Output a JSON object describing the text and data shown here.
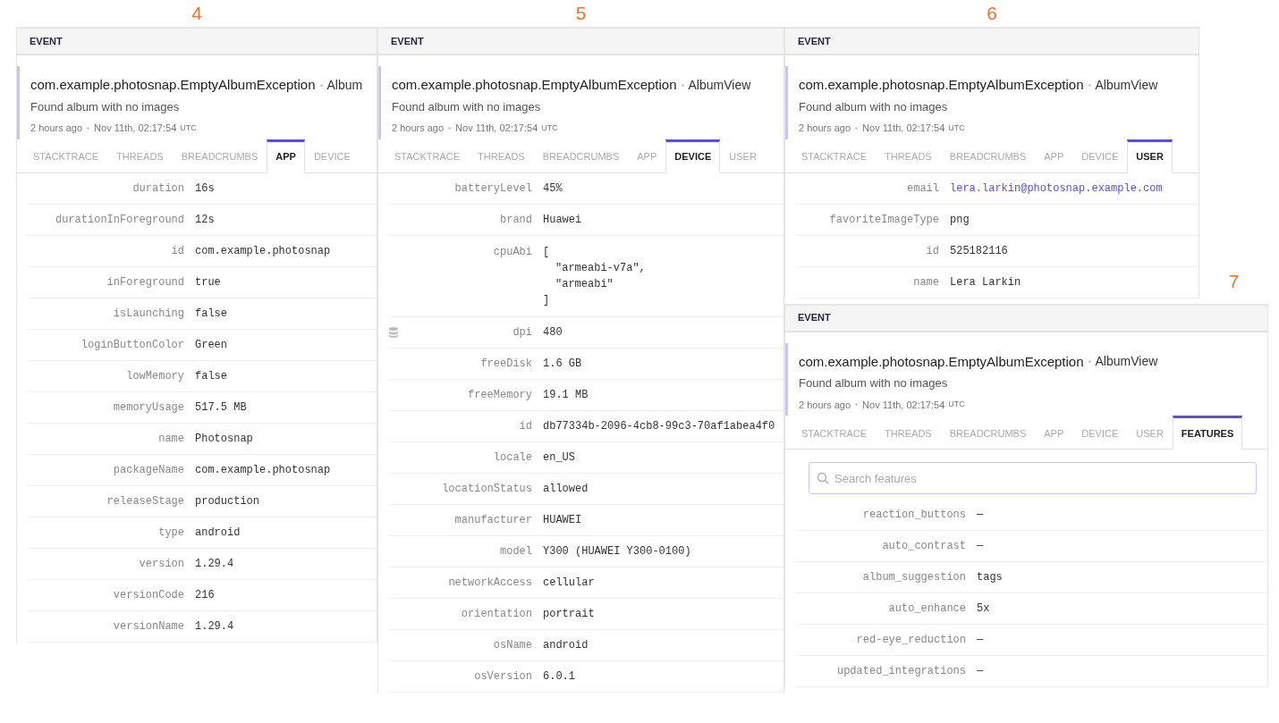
{
  "panels": [
    {
      "number": "4",
      "header": "EVENT",
      "error_class": "com.example.photosnap.EmptyAlbumException",
      "context": "Album",
      "message": "Found album with no images",
      "relative_time": "2 hours ago",
      "timestamp": "Nov 11th, 02:17:54",
      "timezone": "UTC",
      "tabs": [
        {
          "label": "STACKTRACE",
          "selected": false
        },
        {
          "label": "THREADS",
          "selected": false
        },
        {
          "label": "BREADCRUMBS",
          "selected": false
        },
        {
          "label": "APP",
          "selected": true
        },
        {
          "label": "DEVICE",
          "selected": false
        }
      ],
      "rows": [
        {
          "kind": "plain",
          "key": "duration",
          "value": "16s"
        },
        {
          "kind": "plain",
          "key": "durationInForeground",
          "value": "12s"
        },
        {
          "kind": "plain",
          "key": "id",
          "value": "com.example.photosnap"
        },
        {
          "kind": "plain",
          "key": "inForeground",
          "value": "true"
        },
        {
          "kind": "plain",
          "key": "isLaunching",
          "value": "false"
        },
        {
          "kind": "plain",
          "key": "loginButtonColor",
          "value": "Green"
        },
        {
          "kind": "plain",
          "key": "lowMemory",
          "value": "false"
        },
        {
          "kind": "plain",
          "key": "memoryUsage",
          "value": "517.5 MB"
        },
        {
          "kind": "plain",
          "key": "name",
          "value": "Photosnap"
        },
        {
          "kind": "plain",
          "key": "packageName",
          "value": "com.example.photosnap"
        },
        {
          "kind": "plain",
          "key": "releaseStage",
          "value": "production"
        },
        {
          "kind": "plain",
          "key": "type",
          "value": "android"
        },
        {
          "kind": "plain",
          "key": "version",
          "value": "1.29.4"
        },
        {
          "kind": "plain",
          "key": "versionCode",
          "value": "216"
        },
        {
          "kind": "plain",
          "key": "versionName",
          "value": "1.29.4"
        }
      ]
    },
    {
      "number": "5",
      "header": "EVENT",
      "error_class": "com.example.photosnap.EmptyAlbumException",
      "context": "AlbumView",
      "message": "Found album with no images",
      "relative_time": "2 hours ago",
      "timestamp": "Nov 11th, 02:17:54",
      "timezone": "UTC",
      "tabs": [
        {
          "label": "STACKTRACE",
          "selected": false
        },
        {
          "label": "THREADS",
          "selected": false
        },
        {
          "label": "BREADCRUMBS",
          "selected": false
        },
        {
          "label": "APP",
          "selected": false
        },
        {
          "label": "DEVICE",
          "selected": true
        },
        {
          "label": "USER",
          "selected": false
        }
      ],
      "rows": [
        {
          "kind": "plain",
          "key": "batteryLevel",
          "value": "45%"
        },
        {
          "kind": "plain",
          "key": "brand",
          "value": "Huawei"
        },
        {
          "kind": "lines",
          "key": "cpuAbi",
          "lines": [
            "[",
            "\"armeabi-v7a\",",
            "\"armeabi\"",
            "]"
          ]
        },
        {
          "kind": "marked",
          "key": "dpi",
          "value": "480"
        },
        {
          "kind": "plain",
          "key": "freeDisk",
          "value": "1.6 GB"
        },
        {
          "kind": "plain",
          "key": "freeMemory",
          "value": "19.1 MB"
        },
        {
          "kind": "plain",
          "key": "id",
          "value": "db77334b-2096-4cb8-99c3-70af1abea4f0"
        },
        {
          "kind": "plain",
          "key": "locale",
          "value": "en_US"
        },
        {
          "kind": "plain",
          "key": "locationStatus",
          "value": "allowed"
        },
        {
          "kind": "plain",
          "key": "manufacturer",
          "value": "HUAWEI"
        },
        {
          "kind": "plain",
          "key": "model",
          "value": "Y300 (HUAWEI Y300-0100)"
        },
        {
          "kind": "plain",
          "key": "networkAccess",
          "value": "cellular"
        },
        {
          "kind": "plain",
          "key": "orientation",
          "value": "portrait"
        },
        {
          "kind": "plain",
          "key": "osName",
          "value": "android"
        },
        {
          "kind": "plain",
          "key": "osVersion",
          "value": "6.0.1"
        }
      ]
    },
    {
      "number": "6",
      "header": "EVENT",
      "error_class": "com.example.photosnap.EmptyAlbumException",
      "context": "AlbumView",
      "message": "Found album with no images",
      "relative_time": "2 hours ago",
      "timestamp": "Nov 11th, 02:17:54",
      "timezone": "UTC",
      "tabs": [
        {
          "label": "STACKTRACE",
          "selected": false
        },
        {
          "label": "THREADS",
          "selected": false
        },
        {
          "label": "BREADCRUMBS",
          "selected": false
        },
        {
          "label": "APP",
          "selected": false
        },
        {
          "label": "DEVICE",
          "selected": false
        },
        {
          "label": "USER",
          "selected": true
        }
      ],
      "rows": [
        {
          "kind": "link",
          "key": "email",
          "value": "lera.larkin@photosnap.example.com"
        },
        {
          "kind": "plain",
          "key": "favoriteImageType",
          "value": "png"
        },
        {
          "kind": "plain",
          "key": "id",
          "value": "525182116"
        },
        {
          "kind": "plain",
          "key": "name",
          "value": "Lera Larkin"
        }
      ]
    },
    {
      "number": "7",
      "header": "EVENT",
      "error_class": "com.example.photosnap.EmptyAlbumException",
      "context": "AlbumView",
      "message": "Found album with no images",
      "relative_time": "2 hours ago",
      "timestamp": "Nov 11th, 02:17:54",
      "timezone": "UTC",
      "tabs": [
        {
          "label": "STACKTRACE",
          "selected": false
        },
        {
          "label": "THREADS",
          "selected": false
        },
        {
          "label": "BREADCRUMBS",
          "selected": false
        },
        {
          "label": "APP",
          "selected": false
        },
        {
          "label": "DEVICE",
          "selected": false
        },
        {
          "label": "USER",
          "selected": false
        },
        {
          "label": "FEATURES",
          "selected": true
        }
      ],
      "search": {
        "placeholder": "Search features"
      },
      "rows": [
        {
          "kind": "plain",
          "key": "reaction_buttons",
          "value": "—"
        },
        {
          "kind": "plain",
          "key": "auto_contrast",
          "value": "—"
        },
        {
          "kind": "plain",
          "key": "album_suggestion",
          "value": "tags"
        },
        {
          "kind": "plain",
          "key": "auto_enhance",
          "value": "5x"
        },
        {
          "kind": "plain",
          "key": "red-eye_reduction",
          "value": "—"
        },
        {
          "kind": "plain",
          "key": "updated_integrations",
          "value": "—"
        }
      ]
    }
  ]
}
